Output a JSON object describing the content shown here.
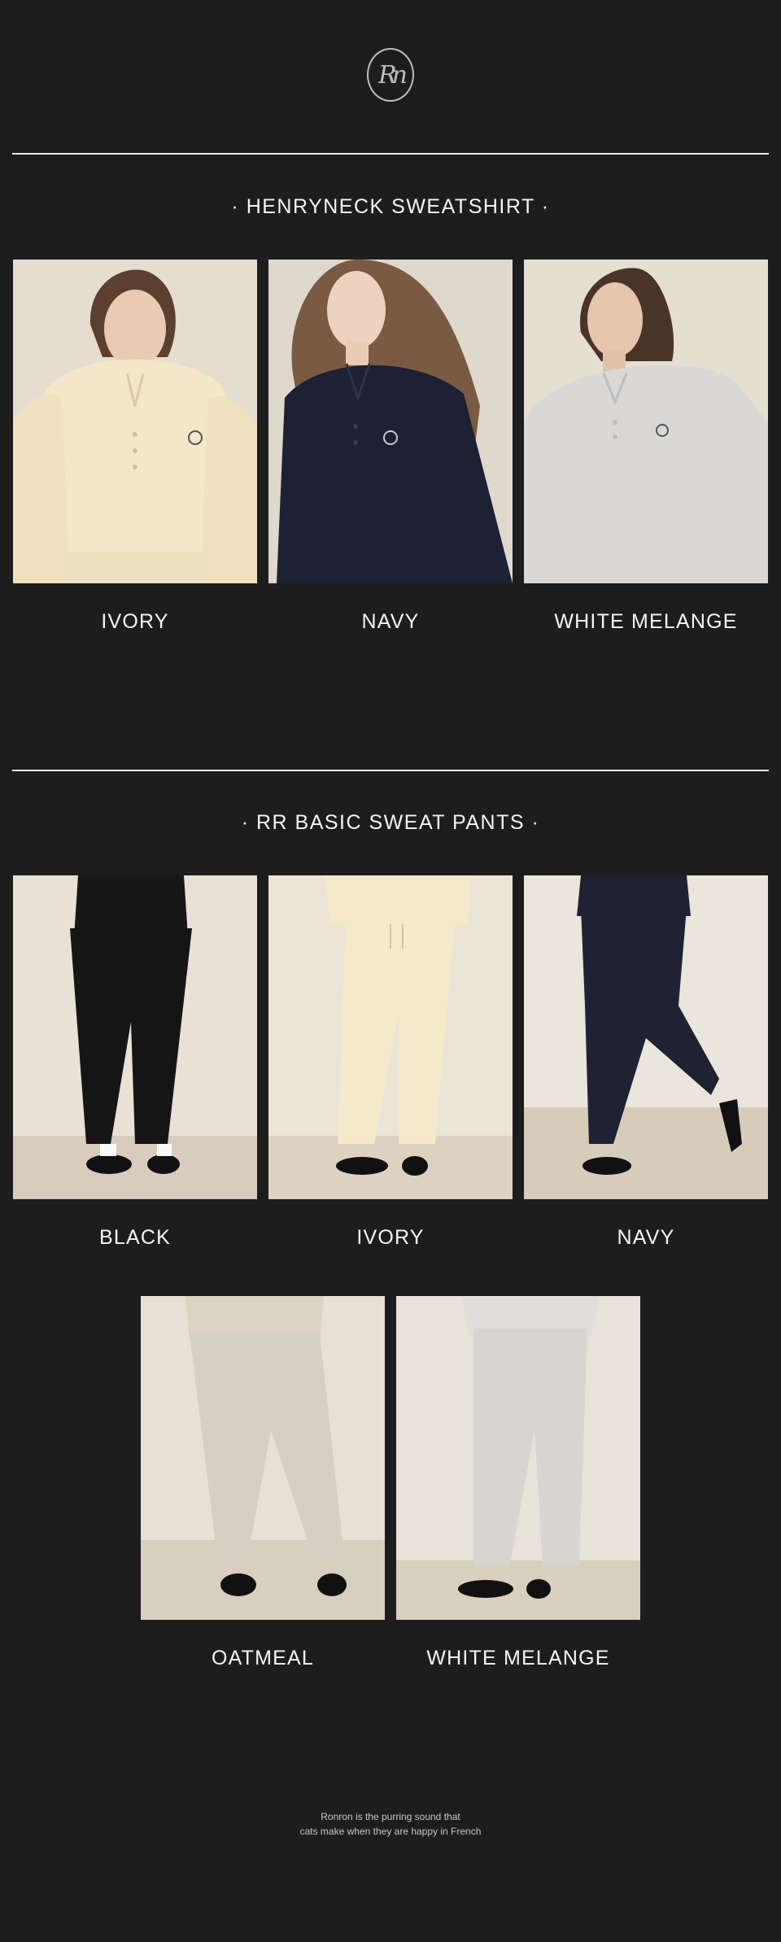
{
  "brand": {
    "logo_text": "Rn",
    "logo_icon": "ronron-monogram-icon"
  },
  "sections": [
    {
      "title": "· HENRYNECK SWEATSHIRT ·",
      "items": [
        {
          "label": "IVORY",
          "color": "#f3e7c7"
        },
        {
          "label": "NAVY",
          "color": "#1c2133"
        },
        {
          "label": "WHITE MELANGE",
          "color": "#d9d8d6"
        }
      ]
    },
    {
      "title": "· RR BASIC SWEAT PANTS ·",
      "items": [
        {
          "label": "BLACK",
          "color": "#151515"
        },
        {
          "label": "IVORY",
          "color": "#f4e9c9"
        },
        {
          "label": "NAVY",
          "color": "#1e2233"
        },
        {
          "label": "OATMEAL",
          "color": "#d6d0c4"
        },
        {
          "label": "WHITE MELANGE",
          "color": "#d8d6d1"
        }
      ]
    }
  ],
  "footer": {
    "line1": "Ronron is the purring sound that",
    "line2": "cats make when they are happy in French"
  }
}
